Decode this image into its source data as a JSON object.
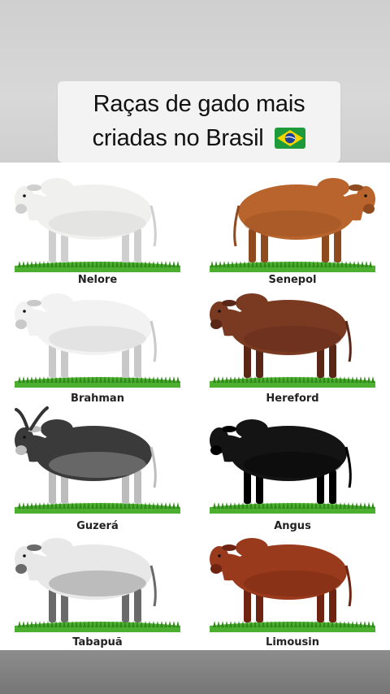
{
  "title": {
    "line1": "Raças de gado mais",
    "line2": "criadas no Brasil"
  },
  "flag_icon": "brazil-flag-emoji",
  "breeds": [
    {
      "name": "Nelore",
      "coat": "#f0f0ee",
      "shade": "#cfcfcf"
    },
    {
      "name": "Senepol",
      "coat": "#b8642c",
      "shade": "#8f4a1f"
    },
    {
      "name": "Brahman",
      "coat": "#f2f2f2",
      "shade": "#c9c9c9"
    },
    {
      "name": "Hereford",
      "coat": "#7a3a22",
      "shade": "#5a2616"
    },
    {
      "name": "Guzerá",
      "coat": "#3a3a3a",
      "shade": "#bdbdbd"
    },
    {
      "name": "Angus",
      "coat": "#141414",
      "shade": "#000000"
    },
    {
      "name": "Tabapuã",
      "coat": "#e8e8e8",
      "shade": "#6a6a6a"
    },
    {
      "name": "Limousin",
      "coat": "#9a3a1c",
      "shade": "#6e2410"
    }
  ],
  "colors": {
    "grass": "#4caf2f",
    "grass_dark": "#2f8a1a"
  }
}
